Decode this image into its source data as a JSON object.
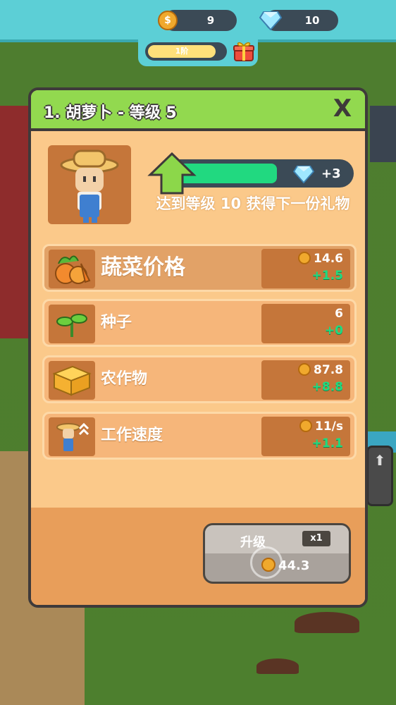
{
  "hud": {
    "coins": "9",
    "gems": "10",
    "stage_label": "1阶"
  },
  "modal": {
    "title": "1. 胡萝卜 - 等级 5",
    "close_label": "X",
    "progress": 0.6,
    "gem_reward": "+3",
    "next_gift_text": "达到等级 10 获得下一份礼物",
    "stats": [
      {
        "label": "蔬菜价格",
        "value": "14.6",
        "bonus": "+1.5",
        "has_coin": true,
        "icon": "vegetables-icon",
        "highlight": true
      },
      {
        "label": "种子",
        "value": "6",
        "bonus": "+0",
        "has_coin": false,
        "icon": "sprout-icon",
        "highlight": false
      },
      {
        "label": "农作物",
        "value": "87.8",
        "bonus": "+8.8",
        "has_coin": true,
        "icon": "hay-bale-icon",
        "highlight": false
      },
      {
        "label": "工作速度",
        "value": "11/s",
        "bonus": "+1.1",
        "has_coin": true,
        "icon": "farmer-speed-icon",
        "highlight": false
      }
    ],
    "upgrade": {
      "label": "升级",
      "multiplier": "x1",
      "cost": "44.3"
    }
  },
  "colors": {
    "header_green": "#92d94f",
    "panel": "#fbc98a",
    "progress_green": "#21d980",
    "hud_teal": "#5ccfd6"
  }
}
